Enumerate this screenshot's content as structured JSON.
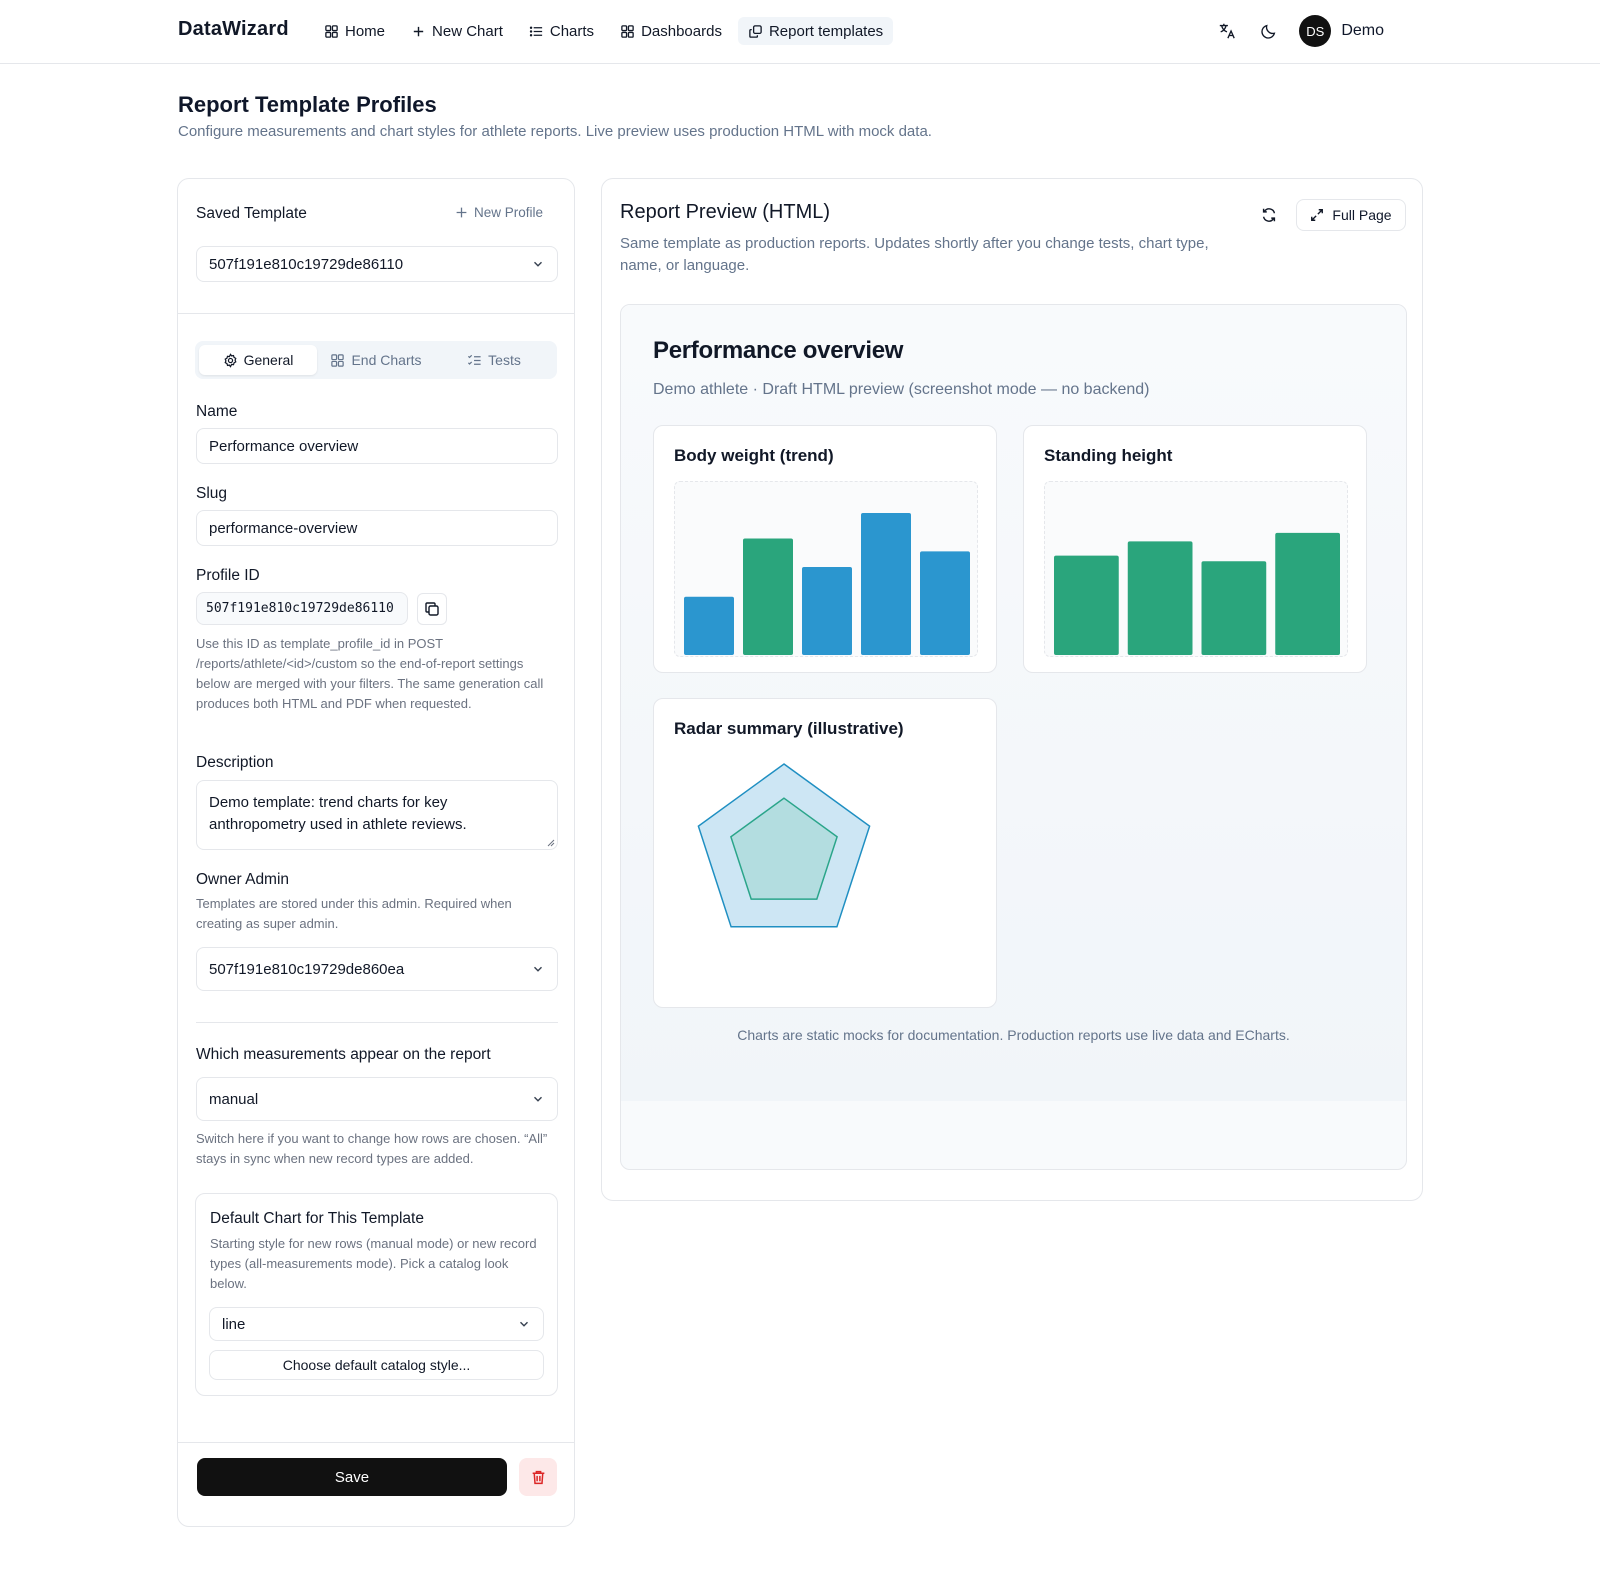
{
  "app": {
    "brand": "DataWizard",
    "nav": [
      {
        "label": "Home",
        "icon": "grid-icon"
      },
      {
        "label": "New Chart",
        "icon": "plus-icon"
      },
      {
        "label": "Charts",
        "icon": "list-icon"
      },
      {
        "label": "Dashboards",
        "icon": "grid-icon"
      },
      {
        "label": "Report templates",
        "icon": "copy-icon",
        "active": true
      }
    ],
    "user": {
      "initials": "DS",
      "name": "Demo"
    }
  },
  "page": {
    "title": "Report Template Profiles",
    "subtitle": "Configure measurements and chart styles for athlete reports. Live preview uses production HTML with mock data."
  },
  "left": {
    "saved_template_label": "Saved Template",
    "new_profile": "New Profile",
    "saved_template_value": "507f191e810c19729de86110",
    "tabs": [
      "General",
      "End Charts",
      "Tests"
    ],
    "active_tab": "General",
    "name_label": "Name",
    "name_value": "Performance overview",
    "slug_label": "Slug",
    "slug_value": "performance-overview",
    "profile_id_label": "Profile ID",
    "profile_id_value": "507f191e810c19729de86110",
    "profile_id_hint": "Use this ID as template_profile_id in POST /reports/athlete/<id>/custom so the end-of-report settings below are merged with your filters. The same generation call produces both HTML and PDF when requested.",
    "description_label": "Description",
    "description_value": "Demo template: trend charts for key anthropometry used in athlete reviews.",
    "owner_label": "Owner Admin",
    "owner_hint": "Templates are stored under this admin. Required when creating as super admin.",
    "owner_value": "507f191e810c19729de860ea",
    "measurements_label": "Which measurements appear on the report",
    "measurements_value": "manual",
    "measurements_hint": "Switch here if you want to change how rows are chosen. “All” stays in sync when new record types are added.",
    "default_chart_title": "Default Chart for This Template",
    "default_chart_hint": "Starting style for new rows (manual mode) or new record types (all-measurements mode). Pick a catalog look below.",
    "default_chart_value": "line",
    "catalog_button": "Choose default catalog style...",
    "save": "Save"
  },
  "preview": {
    "title": "Report Preview (HTML)",
    "subtitle": "Same template as production reports. Updates shortly after you change tests, chart type, name, or language.",
    "full_page": "Full Page",
    "report_title": "Performance overview",
    "report_subtitle": "Demo athlete · Draft HTML preview (screenshot mode — no backend)",
    "footer": "Charts are static mocks for documentation. Production reports use live data and ECharts."
  },
  "colors": {
    "blue": "#2b96cf",
    "green": "#2aa57c",
    "radar_outer": "#1f8fc2",
    "radar_inner": "#2aa58a"
  },
  "chart_data": [
    {
      "type": "bar",
      "title": "Body weight (trend)",
      "values": [
        0.41,
        0.82,
        0.62,
        1.0,
        0.73
      ],
      "colors": [
        "#2b96cf",
        "#2aa57c",
        "#2b96cf",
        "#2b96cf",
        "#2b96cf"
      ]
    },
    {
      "type": "bar",
      "title": "Standing height",
      "values": [
        0.7,
        0.8,
        0.66,
        0.86
      ],
      "colors": [
        "#2aa57c",
        "#2aa57c",
        "#2aa57c",
        "#2aa57c"
      ]
    },
    {
      "type": "radar",
      "title": "Radar summary (illustrative)",
      "axes": 5,
      "series": [
        {
          "values": [
            1,
            1,
            1,
            1,
            1
          ]
        },
        {
          "values": [
            0.62,
            0.62,
            0.62,
            0.62,
            0.62
          ]
        }
      ]
    }
  ]
}
